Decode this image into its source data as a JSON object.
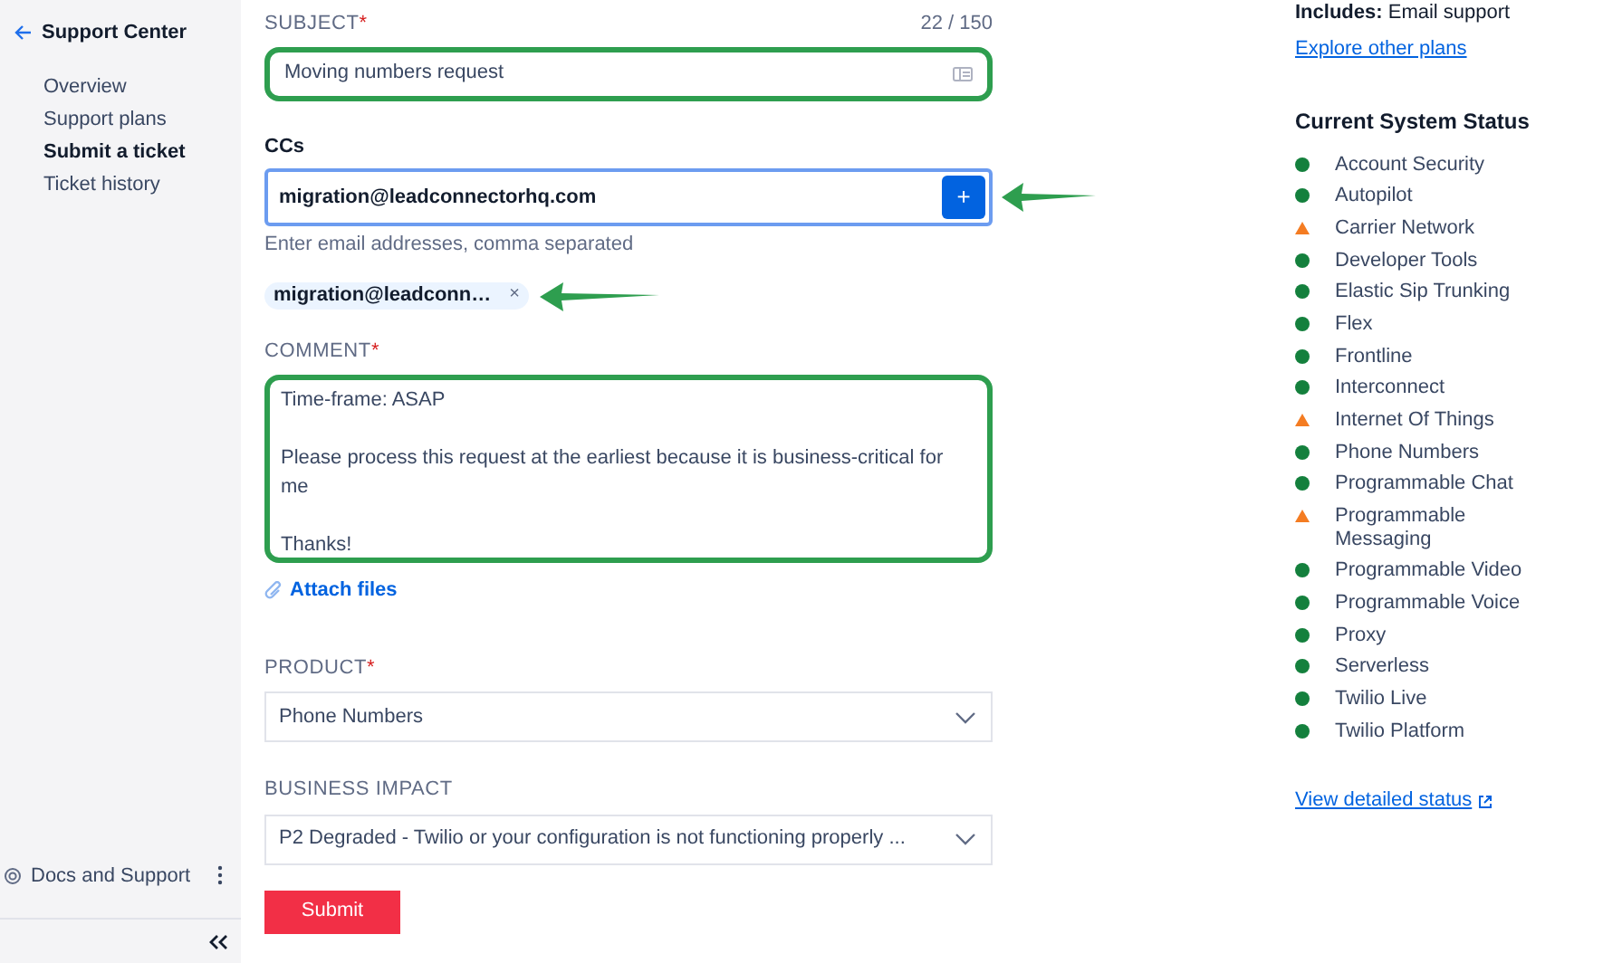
{
  "sidebar": {
    "back_title": "Support Center",
    "items": [
      {
        "label": "Overview",
        "selected": false
      },
      {
        "label": "Support plans",
        "selected": false
      },
      {
        "label": "Submit a ticket",
        "selected": true
      },
      {
        "label": "Ticket history",
        "selected": false
      }
    ],
    "footer": "Docs and Support"
  },
  "form": {
    "subject": {
      "label": "SUBJECT",
      "required_mark": "*",
      "counter": "22 / 150",
      "value": "Moving numbers request",
      "highlighted": true
    },
    "ccs": {
      "label": "CCs",
      "value": "migration@leadconnectorhq.com",
      "button": "+",
      "hint": "Enter email addresses, comma separated",
      "arrow": true
    },
    "chips": [
      {
        "label": "migration@leadconn…",
        "remove": "×",
        "arrow": true
      }
    ],
    "comment": {
      "label": "COMMENT",
      "required_mark": "*",
      "value": "Time-frame: ASAP\n\nPlease process this request at the earliest because it is business-critical for me\n\nThanks!",
      "highlighted": true
    },
    "attach": "Attach files",
    "product": {
      "label": "PRODUCT",
      "required_mark": "*",
      "value": "Phone Numbers"
    },
    "impact": {
      "label": "BUSINESS IMPACT",
      "value": "P2 Degraded - Twilio or your configuration is not functioning properly ..."
    },
    "submit": "Submit"
  },
  "plan": {
    "includes_label": "Includes:",
    "includes_value": "Email support",
    "link": "Explore other plans"
  },
  "status": {
    "title": "Current System Status",
    "items": [
      {
        "name": "Account Security",
        "kind": "ok"
      },
      {
        "name": "Autopilot",
        "kind": "ok"
      },
      {
        "name": "Carrier Network",
        "kind": "warning"
      },
      {
        "name": "Developer Tools",
        "kind": "ok"
      },
      {
        "name": "Elastic Sip Trunking",
        "kind": "ok"
      },
      {
        "name": "Flex",
        "kind": "ok"
      },
      {
        "name": "Frontline",
        "kind": "ok"
      },
      {
        "name": "Interconnect",
        "kind": "ok"
      },
      {
        "name": "Internet Of Things",
        "kind": "warning"
      },
      {
        "name": "Phone Numbers",
        "kind": "ok"
      },
      {
        "name": "Programmable Chat",
        "kind": "ok"
      },
      {
        "name": "Programmable Messaging",
        "kind": "warning"
      },
      {
        "name": "Programmable Video",
        "kind": "ok"
      },
      {
        "name": "Programmable Voice",
        "kind": "ok"
      },
      {
        "name": "Proxy",
        "kind": "ok"
      },
      {
        "name": "Serverless",
        "kind": "ok"
      },
      {
        "name": "Twilio Live",
        "kind": "ok"
      },
      {
        "name": "Twilio Platform",
        "kind": "ok"
      }
    ],
    "link": "View detailed status"
  }
}
